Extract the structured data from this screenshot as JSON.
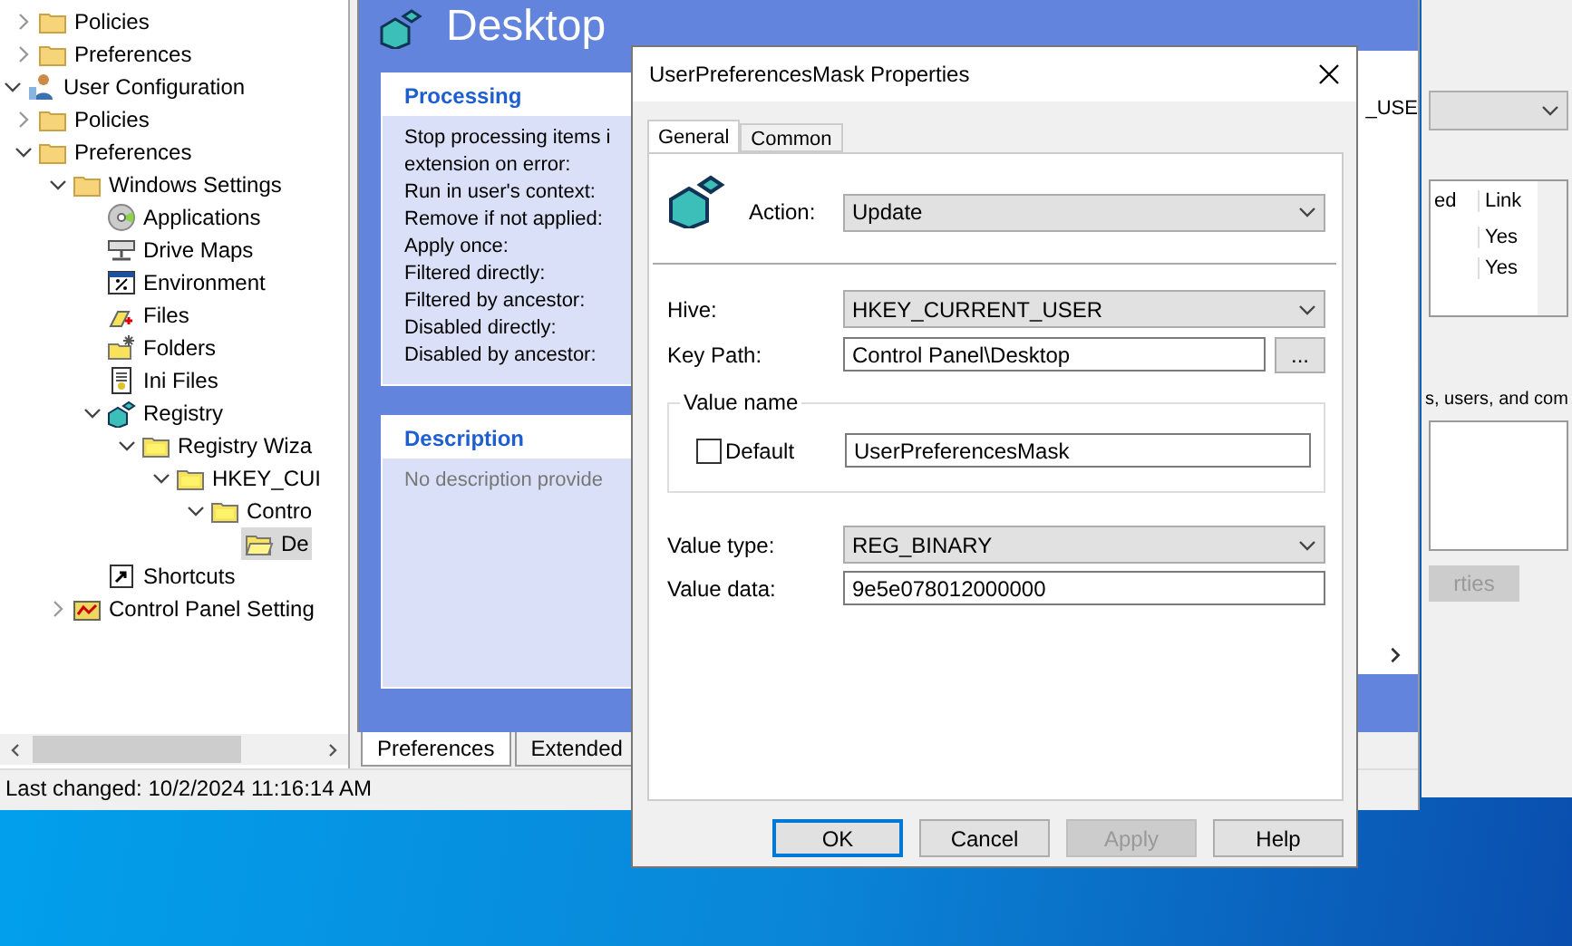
{
  "tree": {
    "items": [
      {
        "children": [
          {
            "label": "Policies",
            "kind": "folder",
            "expanded": false,
            "selected": false
          },
          {
            "label": "Preferences",
            "kind": "folder",
            "expanded": false,
            "selected": false
          }
        ]
      },
      {
        "label": "User Configuration",
        "kind": "user",
        "expanded": true,
        "selected": false,
        "children": [
          {
            "label": "Policies",
            "kind": "folder",
            "expanded": false,
            "selected": false
          },
          {
            "label": "Preferences",
            "kind": "folder",
            "expanded": true,
            "selected": false,
            "children": [
              {
                "label": "Windows Settings",
                "kind": "folder",
                "expanded": true,
                "selected": false,
                "children": [
                  {
                    "label": "Applications",
                    "kind": "disc",
                    "selected": false
                  },
                  {
                    "label": "Drive Maps",
                    "kind": "drive",
                    "selected": false
                  },
                  {
                    "label": "Environment",
                    "kind": "environment",
                    "selected": false
                  },
                  {
                    "label": "Files",
                    "kind": "files",
                    "selected": false
                  },
                  {
                    "label": "Folders",
                    "kind": "folders",
                    "selected": false
                  },
                  {
                    "label": "Ini Files",
                    "kind": "ini",
                    "selected": false
                  },
                  {
                    "label": "Registry",
                    "kind": "registry",
                    "expanded": true,
                    "selected": false,
                    "children": [
                      {
                        "label": "Registry Wiza",
                        "kind": "yfolder",
                        "expanded": true,
                        "selected": false,
                        "children": [
                          {
                            "label": "HKEY_CUI",
                            "kind": "yfolder",
                            "expanded": true,
                            "selected": false,
                            "children": [
                              {
                                "label": "Contro",
                                "kind": "yfolder",
                                "expanded": true,
                                "selected": false,
                                "children": [
                                  {
                                    "label": "De",
                                    "kind": "openfolder",
                                    "selected": true
                                  }
                                ]
                              }
                            ]
                          }
                        ]
                      }
                    ]
                  },
                  {
                    "label": "Shortcuts",
                    "kind": "shortcut",
                    "selected": false
                  }
                ]
              },
              {
                "label": "Control Panel Setting",
                "kind": "controlpanel",
                "expanded": false,
                "selected": false
              }
            ]
          }
        ]
      }
    ]
  },
  "status_bar": "Last changed: 10/2/2024 11:16:14 AM",
  "details": {
    "heading": "Desktop",
    "cards": [
      {
        "title": "Processing",
        "lines": [
          "Stop processing items i",
          "extension on error:",
          "Run in user's context:",
          "Remove if not applied:",
          "Apply once:",
          "Filtered directly:",
          "Filtered by ancestor:",
          "Disabled directly:",
          "Disabled by ancestor:"
        ],
        "muted": false
      },
      {
        "title": "Description",
        "lines": [
          "No description provide"
        ],
        "muted": true
      }
    ],
    "side_text": "_USE",
    "tabs": [
      {
        "label": "Preferences",
        "selected": true
      },
      {
        "label": "Extended",
        "selected": false
      }
    ]
  },
  "right_pane": {
    "columns": [
      "ed",
      "Link"
    ],
    "rows": [
      [
        "",
        "Yes"
      ],
      [
        "",
        "Yes"
      ]
    ],
    "note": "s, users, and com",
    "button": {
      "label": "rties",
      "disabled": true
    }
  },
  "dialog": {
    "title": "UserPreferencesMask Properties",
    "tabs": [
      {
        "label": "General",
        "selected": true
      },
      {
        "label": "Common",
        "selected": false
      }
    ],
    "action": {
      "label": "Action:",
      "value": "Update"
    },
    "hive": {
      "label": "Hive:",
      "value": "HKEY_CURRENT_USER"
    },
    "key_path": {
      "label": "Key Path:",
      "value": "Control Panel\\Desktop",
      "browse": "..."
    },
    "value_name": {
      "legend": "Value name",
      "default_label": "Default",
      "default_checked": false,
      "value": "UserPreferencesMask"
    },
    "value_type": {
      "label": "Value type:",
      "value": "REG_BINARY"
    },
    "value_data": {
      "label": "Value data:",
      "value": "9e5e078012000000"
    },
    "buttons": [
      {
        "label": "OK",
        "default": true,
        "disabled": false
      },
      {
        "label": "Cancel",
        "default": false,
        "disabled": false
      },
      {
        "label": "Apply",
        "default": false,
        "disabled": true
      },
      {
        "label": "Help",
        "default": false,
        "disabled": false
      }
    ]
  }
}
